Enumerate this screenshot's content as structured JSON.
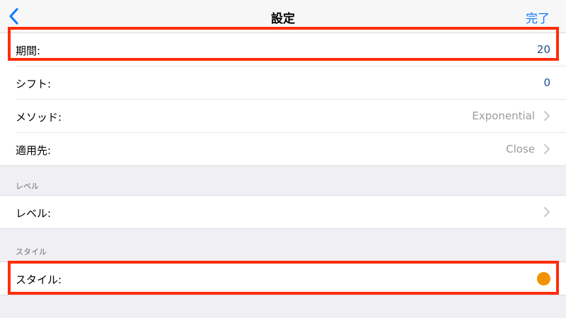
{
  "navbar": {
    "title": "設定",
    "done_label": "完了"
  },
  "group1": {
    "rows": [
      {
        "label": "期間:",
        "value": "20"
      },
      {
        "label": "シフト:",
        "value": "0"
      },
      {
        "label": "メソッド:",
        "value": "Exponential"
      },
      {
        "label": "適用先:",
        "value": "Close"
      }
    ]
  },
  "levels": {
    "header": "レベル",
    "row_label": "レベル:"
  },
  "style": {
    "header": "スタイル",
    "row_label": "スタイル:",
    "color": "#f39200"
  },
  "colors": {
    "accent": "#0a7aff",
    "highlight": "#ff2d0a"
  },
  "icons": {
    "back": "chevron-left-icon",
    "disclosure": "chevron-right-icon",
    "style_color": "color-dot-icon"
  }
}
